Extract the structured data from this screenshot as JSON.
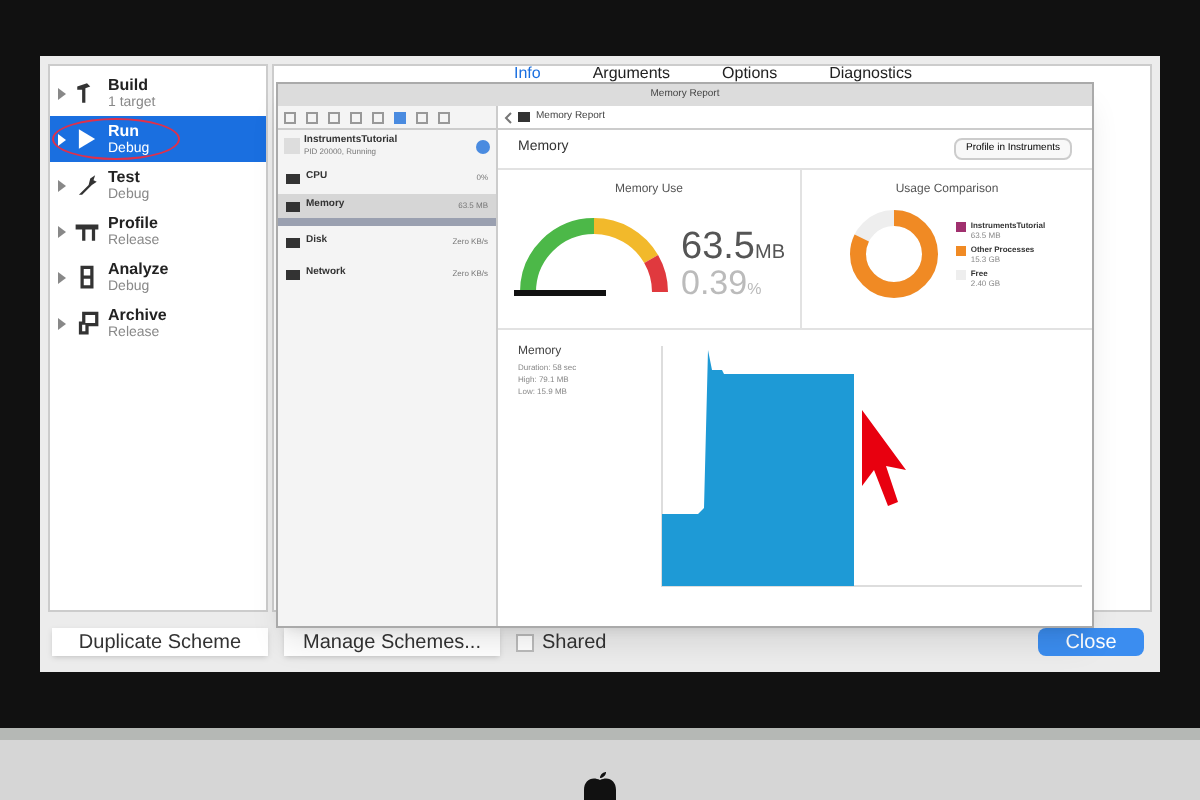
{
  "schemes": [
    {
      "name": "Build",
      "detail": "1 target",
      "selected": false,
      "kind": "build"
    },
    {
      "name": "Run",
      "detail": "Debug",
      "selected": true,
      "kind": "run"
    },
    {
      "name": "Test",
      "detail": "Debug",
      "selected": false,
      "kind": "test"
    },
    {
      "name": "Profile",
      "detail": "Release",
      "selected": false,
      "kind": "profile"
    },
    {
      "name": "Analyze",
      "detail": "Debug",
      "selected": false,
      "kind": "analyze"
    },
    {
      "name": "Archive",
      "detail": "Release",
      "selected": false,
      "kind": "archive"
    }
  ],
  "tabs": [
    {
      "label": "Info",
      "selected": true
    },
    {
      "label": "Arguments",
      "selected": false
    },
    {
      "label": "Options",
      "selected": false
    },
    {
      "label": "Diagnostics",
      "selected": false
    }
  ],
  "report_window": {
    "title": "Memory Report",
    "breadcrumb": "Memory Report",
    "process": {
      "name": "InstrumentsTutorial",
      "status": "PID 20000, Running"
    },
    "gauges": [
      {
        "name": "CPU",
        "value": "0%",
        "selected": false
      },
      {
        "name": "Memory",
        "value": "63.5 MB",
        "selected": true
      },
      {
        "name": "Disk",
        "value": "Zero KB/s",
        "selected": false
      },
      {
        "name": "Network",
        "value": "Zero KB/s",
        "selected": false
      }
    ],
    "heading": "Memory",
    "profile_button": "Profile in Instruments",
    "memory_use": {
      "title": "Memory Use",
      "amount": "63.5",
      "unit": "MB",
      "percent": "0.39",
      "percent_unit": "%"
    },
    "usage": {
      "title": "Usage Comparison",
      "legend": [
        {
          "name": "InstrumentsTutorial",
          "value": "63.5 MB",
          "color": "#a0306e"
        },
        {
          "name": "Other Processes",
          "value": "15.3 GB",
          "color": "#f08a24"
        },
        {
          "name": "Free",
          "value": "2.40 GB",
          "color": "#eeeeee"
        }
      ]
    },
    "graph": {
      "title": "Memory",
      "stats": [
        "Duration: 58 sec",
        "High: 79.1 MB",
        "Low: 15.9 MB"
      ]
    }
  },
  "buttons": {
    "duplicate": "Duplicate Scheme",
    "manage": "Manage Schemes...",
    "close": "Close"
  },
  "shared": {
    "label": "Shared",
    "checked": false
  }
}
